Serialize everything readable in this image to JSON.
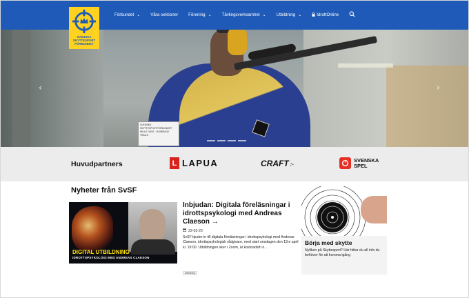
{
  "nav": {
    "logo_lines": [
      "SVENSKA",
      "SKYTTESPORT",
      "FÖRBUNDET"
    ],
    "items": [
      {
        "label": "Förbundet",
        "chevron": "⌄"
      },
      {
        "label": "Våra sektioner",
        "chevron": ""
      },
      {
        "label": "Förening",
        "chevron": "⌄"
      },
      {
        "label": "Tävlingsverksamhet",
        "chevron": "⌄"
      },
      {
        "label": "Utbildning",
        "chevron": "⌄"
      },
      {
        "label": "IdrottOnline",
        "chevron": "",
        "icon": "lock-icon"
      }
    ],
    "search_icon": "search-icon"
  },
  "hero": {
    "prev_arrow": "‹",
    "next_arrow": "›",
    "bib_text": "SVENSKA SKYTTESPORTFÖRBUNDET MILLE DAYS · HOMMAGE TRAILS"
  },
  "partners": {
    "title": "Huvudpartners",
    "lapua": {
      "mark": "L",
      "name": "LAPUA"
    },
    "craft": {
      "name": "CRAFT",
      "suffix": ":·"
    },
    "svenska_spel": {
      "line1": "SVENSKA",
      "line2": "SPEL"
    }
  },
  "news": {
    "heading": "Nyheter från SvSF",
    "image_title": "DIGITAL UTBILDNING",
    "image_subtitle": "IDROTTSPSYKOLOGI MED ANDREAS CLAESON",
    "article_title": "Inbjudan: Digitala föreläsningar i idrottspsykologi med Andreas Claeson →",
    "date": "22-03-20",
    "excerpt": "SvSF bjuder in till digitala föreläsningar i idrottspsykologi med Andreas Claeson, idrottspsykologisk rådgivare, med start onsdagen den 19:e april kl. 19:00. Utbildningen sker i Zoom, är kostnadsfri o...",
    "tag": "Utbildning"
  },
  "card": {
    "title": "Börja med skytte",
    "text": "Nyfiken på Skyttesport? Här hittar du all info du behöver för att komma igång"
  },
  "colors": {
    "nav_blue": "#1f5ab8",
    "logo_yellow": "#ffd21f",
    "lapua_red": "#d9231d",
    "svenska_spel_red": "#e63026",
    "partners_bg": "#ececec"
  }
}
